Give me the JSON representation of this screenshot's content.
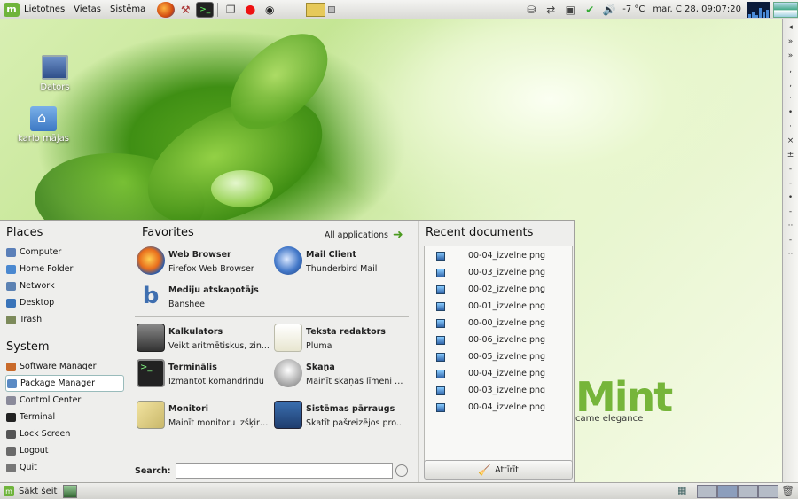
{
  "top_panel": {
    "menus": [
      "Lietotnes",
      "Vietas",
      "Sistēma"
    ],
    "weather": "-7 °C",
    "clock": "mar. C  28, 09:07:20"
  },
  "desktop": {
    "icons": [
      {
        "label": "Dators"
      },
      {
        "label": "karlo mājas"
      }
    ]
  },
  "menu": {
    "places": {
      "title": "Places",
      "items": [
        "Computer",
        "Home Folder",
        "Network",
        "Desktop",
        "Trash"
      ]
    },
    "system": {
      "title": "System",
      "items": [
        "Software Manager",
        "Package Manager",
        "Control Center",
        "Terminal",
        "Lock Screen",
        "Logout",
        "Quit"
      ],
      "highlighted": "Package Manager"
    },
    "favorites": {
      "title": "Favorites",
      "all_apps_label": "All applications",
      "apps": [
        {
          "name": "Web Browser",
          "desc": "Firefox Web Browser"
        },
        {
          "name": "Mail Client",
          "desc": "Thunderbird Mail"
        },
        {
          "name": "Mediju atskaņotājs",
          "desc": "Banshee"
        },
        {
          "name": "Kalkulators",
          "desc": "Veikt aritmētiskus, zin..."
        },
        {
          "name": "Teksta redaktors",
          "desc": "Pluma"
        },
        {
          "name": "Terminālis",
          "desc": "Izmantot komandrindu"
        },
        {
          "name": "Skaņa",
          "desc": "Mainīt skaņas līmeni u..."
        },
        {
          "name": "Monitori",
          "desc": "Mainīt monitoru izšķirt..."
        },
        {
          "name": "Sistēmas pārraugs",
          "desc": "Skatīt pašreizējos pro..."
        }
      ],
      "search_label": "Search:",
      "search_value": ""
    },
    "recent": {
      "title": "Recent documents",
      "docs": [
        "00-04_izvelne.png",
        "00-03_izvelne.png",
        "00-02_izvelne.png",
        "00-01_izvelne.png",
        "00-00_izvelne.png",
        "00-06_izvelne.png",
        "00-05_izvelne.png",
        "00-04_izvelne.png",
        "00-03_izvelne.png",
        "00-04_izvelne.png"
      ],
      "clear_label": "Attīrīt"
    }
  },
  "watermark": {
    "brand": "Mint",
    "tagline": "came elegance"
  },
  "bottom_panel": {
    "start_label": "Sākt šeit"
  },
  "colors": {
    "mint_green": "#6fb43b",
    "menu_bg": "#eeeeec"
  }
}
